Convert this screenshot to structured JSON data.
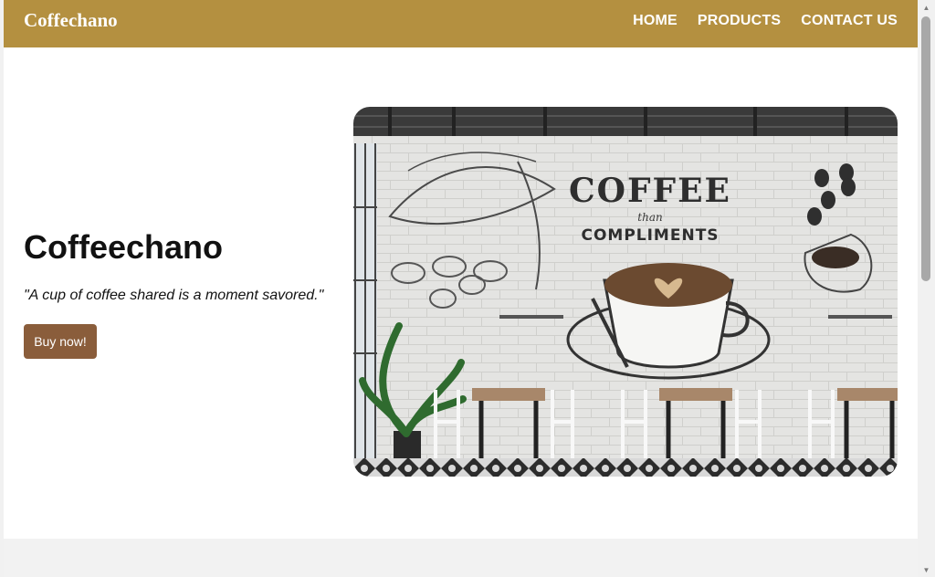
{
  "header": {
    "brand": "Coffechano",
    "nav": [
      {
        "label": "HOME"
      },
      {
        "label": "PRODUCTS"
      },
      {
        "label": "CONTACT US"
      }
    ]
  },
  "hero": {
    "title": "Coffeechano",
    "quote": "\"A cup of coffee shared is a moment savored.\"",
    "button_label": "Buy now!",
    "image": {
      "icon": "cafe-interior-image",
      "mural_title": "COFFEE",
      "mural_subtitle": "than",
      "mural_line": "COMPLIMENTS"
    }
  },
  "colors": {
    "navbar": "#b49040",
    "button": "#8a5d3b",
    "footer_band": "#f2f2f2"
  }
}
